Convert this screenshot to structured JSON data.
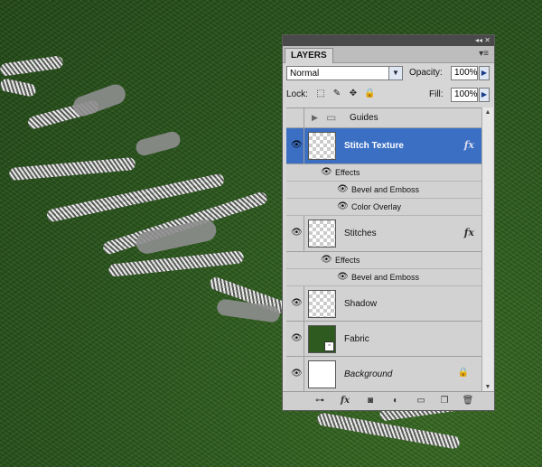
{
  "panel": {
    "title": "LAYERS",
    "blend_mode": "Normal",
    "opacity_label": "Opacity:",
    "opacity_value": "100%",
    "lock_label": "Lock:",
    "fill_label": "Fill:",
    "fill_value": "100%"
  },
  "layers": [
    {
      "name": "Guides",
      "type": "group"
    },
    {
      "name": "Stitch Texture",
      "selected": true,
      "fx": "fx",
      "effects_label": "Effects",
      "effects": [
        "Bevel and Emboss",
        "Color Overlay"
      ]
    },
    {
      "name": "Stitches",
      "fx": "fx",
      "effects_label": "Effects",
      "effects": [
        "Bevel and Emboss"
      ]
    },
    {
      "name": "Shadow"
    },
    {
      "name": "Fabric",
      "thumb_color": "#2f5a1f"
    },
    {
      "name": "Background",
      "locked": true
    }
  ],
  "icons": {
    "eye": "eye-icon",
    "folder": "folder-icon",
    "lock": "lock-icon",
    "link": "link-icon",
    "mask": "add-mask-icon",
    "adjust": "adjustment-layer-icon",
    "new_group": "new-group-icon",
    "new_layer": "new-layer-icon",
    "trash": "trash-icon"
  },
  "colors": {
    "accent": "#3b6fc4",
    "annotation": "#c81515",
    "canvas": "#2f5a1f"
  }
}
